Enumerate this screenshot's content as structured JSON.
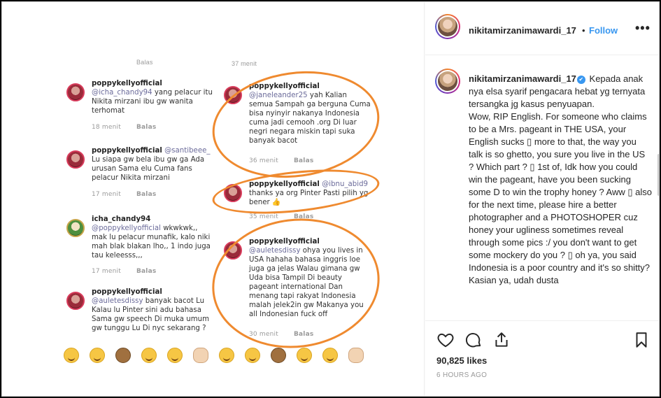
{
  "post": {
    "screenshot": {
      "top_time_label": "37 menit",
      "top_reply_label": "Balas",
      "comments_left": [
        {
          "user": "poppykellyofficial",
          "mention": "@icha_chandy94",
          "text": "yang pelacur itu Nikita mirzani ibu gw wanita terhomat",
          "time": "18 menit",
          "reply": "Balas"
        },
        {
          "user": "poppykellyofficial",
          "mention": "@santibeee_",
          "text": "Lu siapa gw bela ibu gw ga Ada urusan Sama elu Cuma fans pelacur Nikita mirzani",
          "time": "17 menit",
          "reply": "Balas"
        },
        {
          "user": "icha_chandy94",
          "mention": "@poppykellyofficial",
          "text": "wkwkwk,, mak lu pelacur munafik, kalo niki mah blak blakan lho,, 1 indo juga tau keleesss,,,",
          "time": "17 menit",
          "reply": "Balas"
        },
        {
          "user": "poppykellyofficial",
          "mention": "@auletesdissy",
          "text": "banyak bacot Lu Kalau lu Pinter sini adu bahasa Sama gw speech Di muka umum gw tunggu Lu Di nyc sekarang ?",
          "time": "",
          "reply": ""
        }
      ],
      "comments_right": [
        {
          "user": "poppykellyofficial",
          "mention": "@janeleander25",
          "text": "yah Kalian semua Sampah ga berguna Cuma bisa nyinyir nakanya Indonesia cuma jadi cemooh .org Di luar negri negara miskin tapi suka banyak bacot",
          "time": "36 menit",
          "reply": "Balas"
        },
        {
          "user": "poppykellyofficial",
          "mention": "@ibnu_abid9",
          "text": "thanks ya org Pinter Pasti pilih yg bener 👍",
          "time": "35 menit",
          "reply": "Balas"
        },
        {
          "user": "poppykellyofficial",
          "mention": "@auletesdissy",
          "text": "ohya you lives in USA hahaha bahasa inggris loe juga ga jelas Walau gimana gw Uda bisa Tampil Di beauty pageant international Dan menang tapi rakyat Indonesia malah jelek2in gw Makanya you all Indonesian fuck off",
          "time": "30 menit",
          "reply": "Balas"
        }
      ],
      "emoji_names": [
        "tears-of-joy-emoji",
        "grin-emoji",
        "see-no-evil-monkey-emoji",
        "crying-emoji",
        "halo-emoji",
        "clapping-hands-emoji"
      ]
    }
  },
  "header": {
    "username": "nikitamirzanimawardi_17",
    "separator": "•",
    "follow_label": "Follow",
    "more_label": "•••"
  },
  "caption": {
    "username": "nikitamirzanimawardi_17",
    "verified_mark": "✔",
    "text": "Kepada anak nya elsa syarif pengacara hebat yg ternyata tersangka jg kasus penyuapan.",
    "text2": "Wow, RIP English. For someone who claims to be a Mrs. pageant in THE USA, your English sucks ▯ more to that, the way you talk is so ghetto, you sure you live in the US ? Which part ? ▯ 1st of, Idk how you could win the pageant, have you been sucking some D to win the trophy honey ? Aww ▯ also for the next time, please hire a better photographer and a PHOTOSHOPER cuz honey your ugliness sometimes reveal through some pics :/ you don't want to get some mockery do you ? ▯ oh ya, you said Indonesia is a poor country and it's so shitty? Kasian ya, udah dusta"
  },
  "footer": {
    "likes": "90,825 likes",
    "ago": "6 HOURS AGO"
  },
  "colors": {
    "follow": "#3897f0",
    "oval": "#ef8a2f",
    "text": "#262626"
  }
}
